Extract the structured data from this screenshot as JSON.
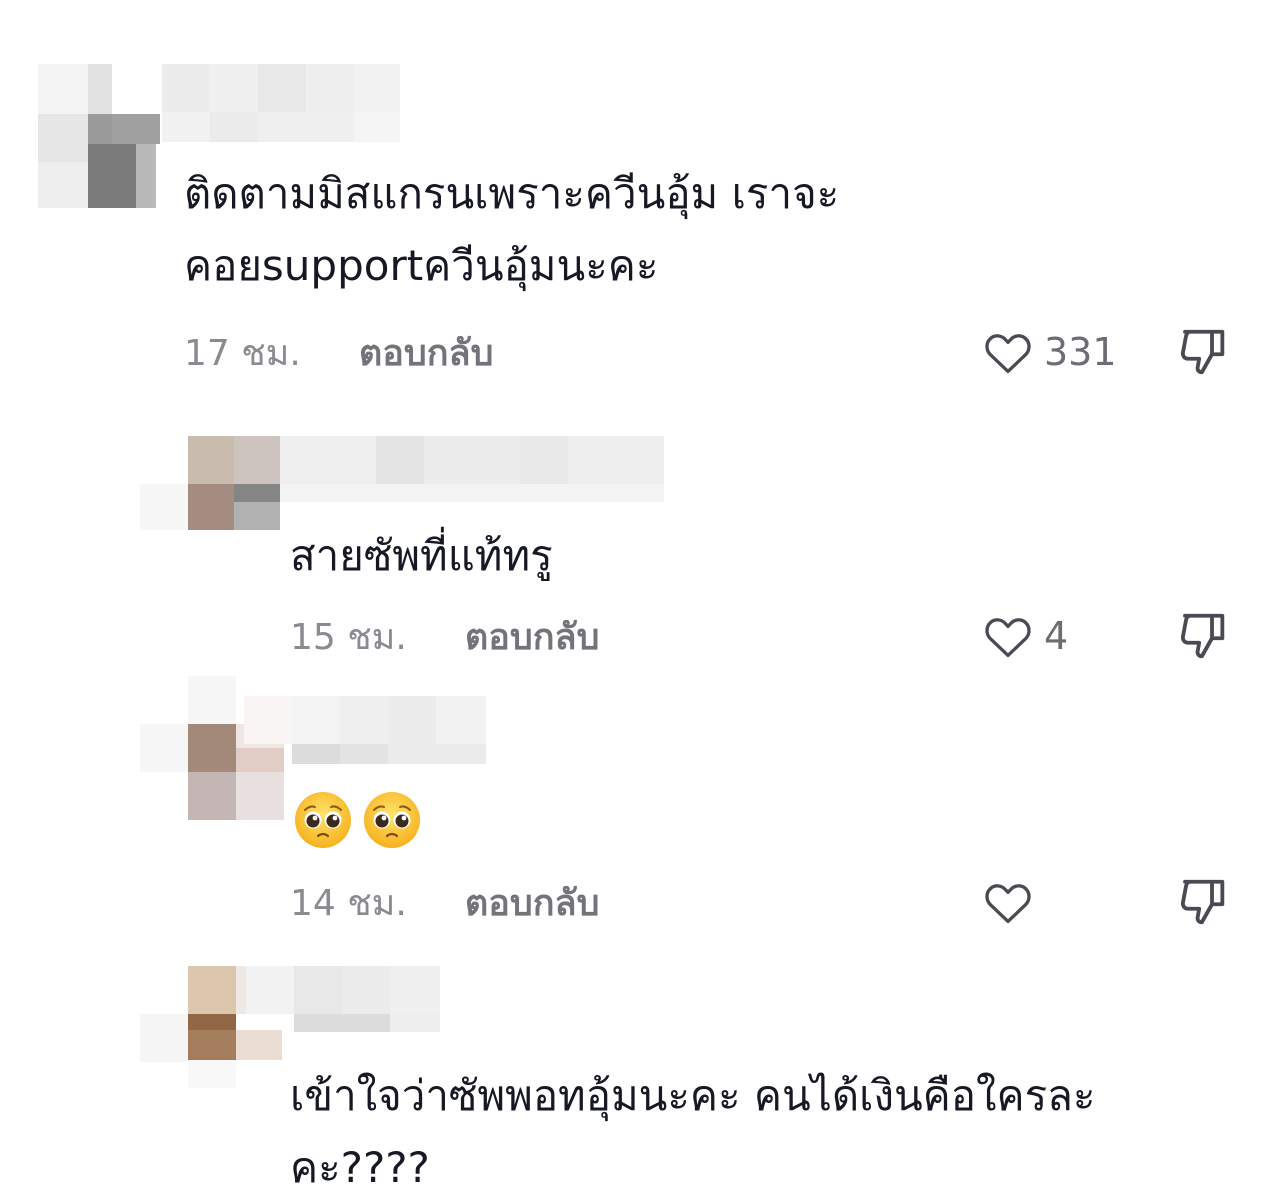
{
  "comments": [
    {
      "text": "ติดตามมิสแกรนเพราะควีนอุ้ม เราจะ\nคอยsupportควีนอุ้มนะคะ",
      "time": "17 ชม.",
      "reply_label": "ตอบกลับ",
      "likes": "331",
      "heart_icon": "heart-outline-icon",
      "dislike_icon": "thumbs-down-icon"
    },
    {
      "text": "สายซัพที่แท้ทรู",
      "time": "15 ชม.",
      "reply_label": "ตอบกลับ",
      "likes": "4",
      "heart_icon": "heart-outline-icon",
      "dislike_icon": "thumbs-down-icon"
    },
    {
      "text": "",
      "emojis": [
        "pleading-face-emoji",
        "pleading-face-emoji"
      ],
      "time": "14 ชม.",
      "reply_label": "ตอบกลับ",
      "likes": "",
      "heart_icon": "heart-outline-icon",
      "dislike_icon": "thumbs-down-icon"
    },
    {
      "text": "เข้าใจว่าซัพพอทอุ้มนะคะ คนได้เงินคือใครละ\nคะ????"
    }
  ],
  "colors": {
    "text": "#161823",
    "meta": "#8a8b91",
    "reply": "#737479",
    "icon": "#4a4b52"
  }
}
